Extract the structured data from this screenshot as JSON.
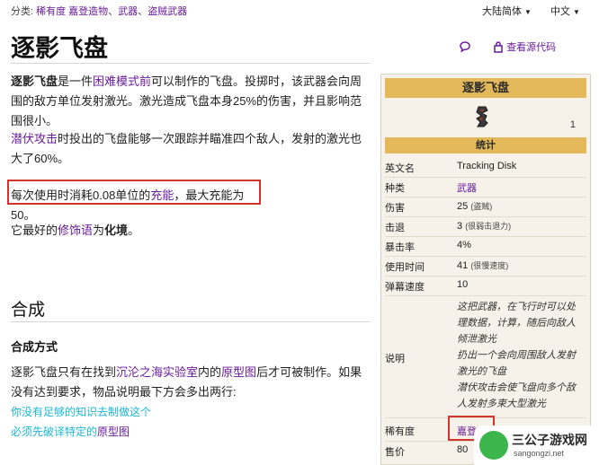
{
  "topbar": {
    "category_prefix": "分类:",
    "categories": [
      "稀有度 嘉登造物",
      "武器",
      "盗贼武器"
    ],
    "separator": "、",
    "variant_label": "大陆简体",
    "language_label": "中文"
  },
  "page": {
    "title": "逐影飞盘",
    "view_source_label": "查看源代码"
  },
  "article": {
    "p1": {
      "bold_name": "逐影飞盘",
      "text_a": "是一件",
      "link_mode": "困难模式前",
      "text_b": "可以制作的飞盘。投掷时，该武器会向周围的敌方单位发射激光。激光造成飞盘本身25%的伤害，并且影响范围很小。"
    },
    "p2": {
      "link": "潜伏攻击",
      "text": "时投出的飞盘能够一次跟踪并瞄准四个敌人，发射的激光也大了60%。"
    },
    "p3": {
      "text_a": "每次使用时消耗0.08单位的",
      "link": "充能",
      "text_b": "，最大充能为50。"
    },
    "p4": {
      "text_a": "它最好的",
      "link": "修饰语",
      "text_b": "为",
      "bold": "化境",
      "text_c": "。"
    },
    "section_heading": "合成",
    "subsection_heading": "合成方式",
    "p5": {
      "text_a": "逐影飞盘只有在找到",
      "link1": "沉沦之海实验室",
      "text_b": "内的",
      "link2": "原型图",
      "text_c": "后才可被制作。如果没有达到要求，物品说明最下方会多出两行:"
    },
    "quote1": "你没有足够的知识去制做这个",
    "quote2_a": "必须先破译特定的",
    "quote2_link": "原型图"
  },
  "infobox": {
    "title": "逐影飞盘",
    "icon": "disk-icon",
    "quantity": "1",
    "stats_header": "统计",
    "rows": [
      {
        "k": "英文名",
        "v": "Tracking Disk"
      },
      {
        "k": "种类",
        "v": "武器"
      },
      {
        "k": "伤害",
        "v": "25",
        "sub": "(盗贼)"
      },
      {
        "k": "击退",
        "v": "3",
        "sub": "(很弱击退力)"
      },
      {
        "k": "暴击率",
        "v": "4%"
      },
      {
        "k": "使用时间",
        "v": "41",
        "sub": "(很慢速度)"
      },
      {
        "k": "弹幕速度",
        "v": "10"
      }
    ],
    "desc_label": "说明",
    "desc_lines": [
      "这把武器，在飞行时可以处",
      "理数据，计算，随后向敌人",
      "倾泄激光",
      "扔出一个会向周围敌人发射",
      "激光的飞盘",
      "潜伏攻击会使飞盘向多个敌",
      "人发射多束大型激光"
    ],
    "rarity_label": "稀有度",
    "rarity_value": "嘉登造",
    "price_label": "售价",
    "price_value": "80"
  },
  "watermark": {
    "title": "三公子游戏网",
    "url": "sangongzi.net"
  },
  "colors": {
    "link": "#6a1b9a",
    "quote": "#19b7d4",
    "infobox_header": "#e3b85a",
    "highlight": "#d0352b"
  }
}
